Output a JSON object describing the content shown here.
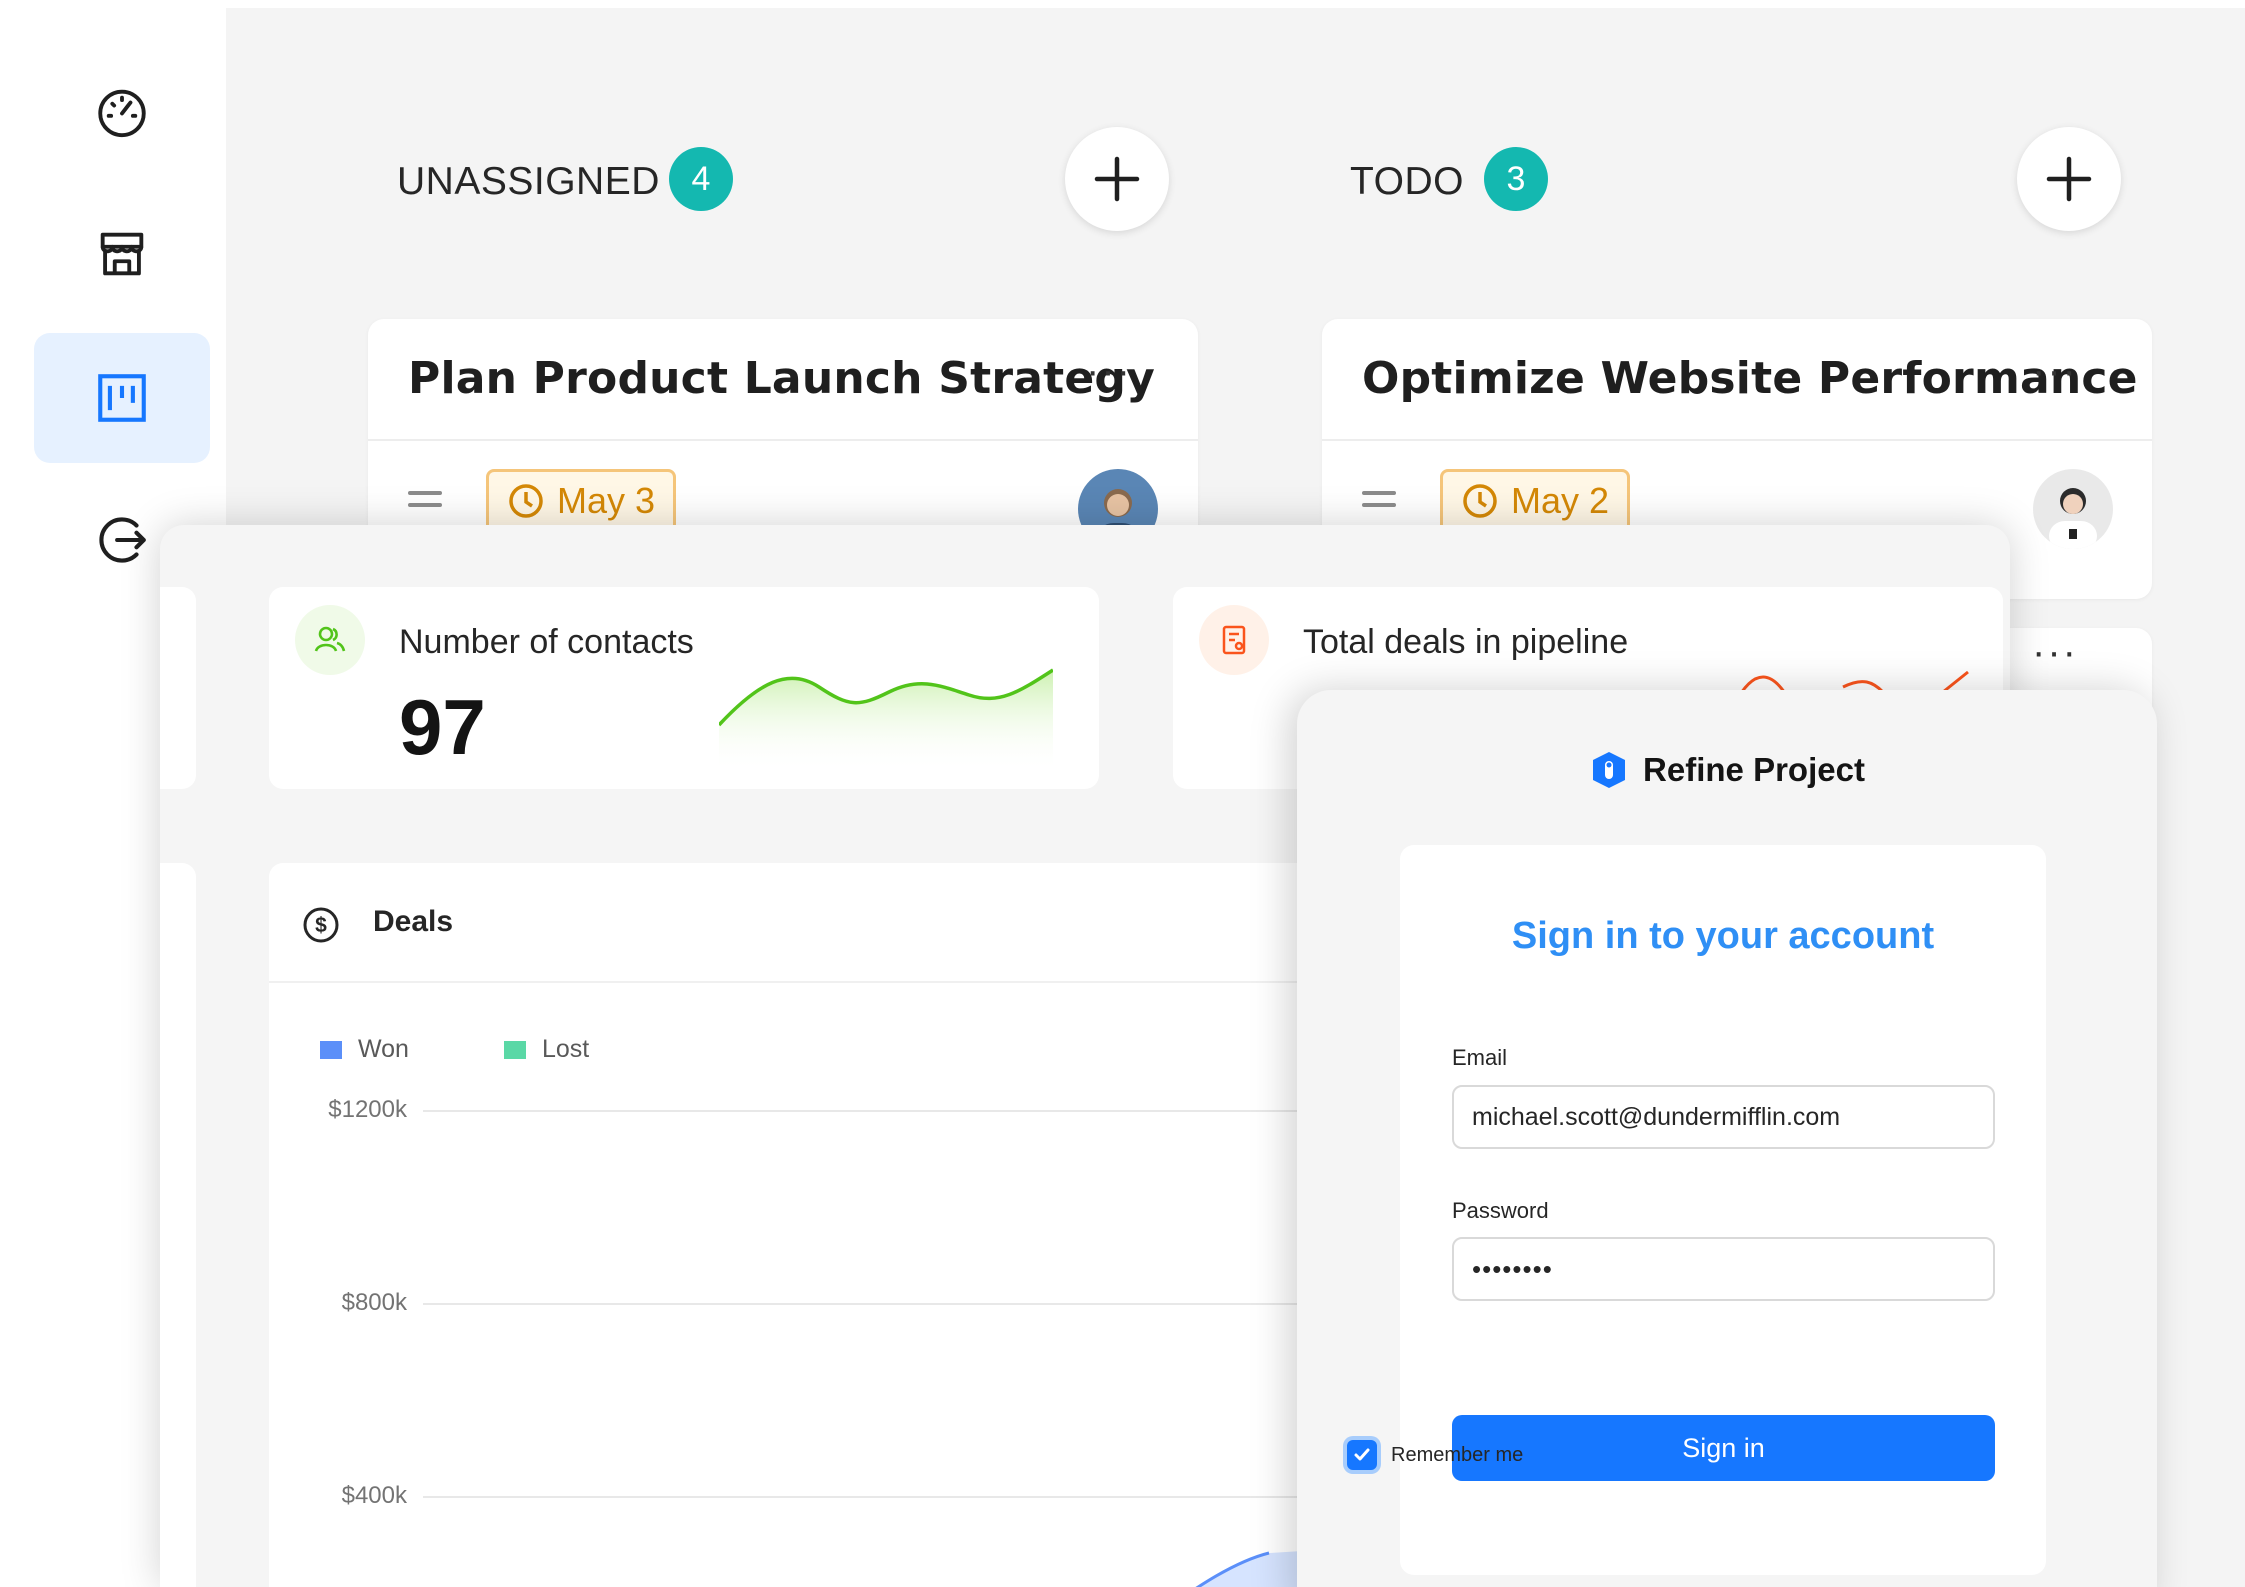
{
  "sidebar": {
    "items": [
      {
        "icon": "dashboard-icon"
      },
      {
        "icon": "store-icon"
      },
      {
        "icon": "kanban-icon",
        "active": true
      },
      {
        "icon": "logout-icon"
      }
    ]
  },
  "kanban": {
    "columns": [
      {
        "title": "UNASSIGNED",
        "count": "4",
        "cards": [
          {
            "title": "Plan Product Launch Strategy",
            "menu": "···",
            "due": "May 3"
          }
        ]
      },
      {
        "title": "TODO",
        "count": "3",
        "cards": [
          {
            "title": "Optimize Website Performance",
            "menu": "···",
            "due": "May 2"
          }
        ]
      }
    ],
    "peek_menu": "···"
  },
  "dashboard": {
    "stats": [
      {
        "label": "Number of contacts",
        "value": "97",
        "color": "#52c41a"
      },
      {
        "label": "Total deals in pipeline",
        "color": "#fa541c"
      }
    ],
    "deals": {
      "title": "Deals",
      "legend": [
        {
          "label": "Won",
          "color": "#5b8ff9"
        },
        {
          "label": "Lost",
          "color": "#5ad8a6"
        }
      ]
    }
  },
  "chart_data": {
    "type": "area",
    "title": "Deals",
    "series": [
      {
        "name": "Won",
        "color": "#5b8ff9"
      },
      {
        "name": "Lost",
        "color": "#5ad8a6"
      }
    ],
    "y_ticks": [
      "$1200k",
      "$800k",
      "$400k"
    ],
    "ylim": [
      0,
      1200
    ],
    "grid": true,
    "legend": "top-left"
  },
  "login": {
    "brand": "Refine Project",
    "heading": "Sign in to your account",
    "email_label": "Email",
    "email_value": "michael.scott@dundermifflin.com",
    "password_label": "Password",
    "password_value": "••••••••",
    "remember_label": "Remember me",
    "remember_checked": true,
    "submit_label": "Sign in"
  }
}
